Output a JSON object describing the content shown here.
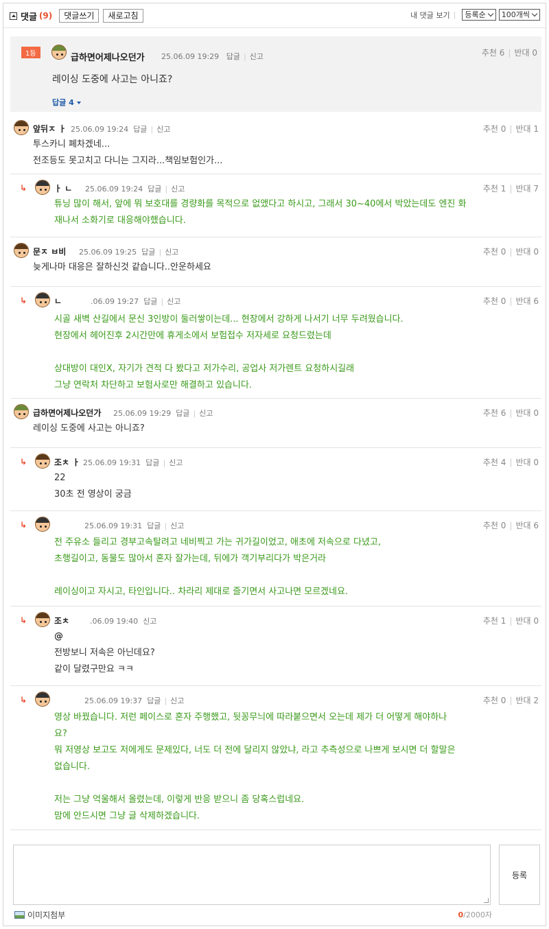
{
  "header": {
    "title": "댓글",
    "count": "(9)",
    "write_button": "댓글쓰기",
    "refresh_button": "새로고침",
    "my_comments": "내 댓글 보기",
    "sort_select": "등록순",
    "per_page_select": "100개씩"
  },
  "best_comment": {
    "badge": "1등",
    "author": "급하면어제나오던가",
    "datetime": "25.06.09 19:29",
    "reply_link": "답글",
    "report_link": "신고",
    "votes": "추천 6",
    "against": "반대 0",
    "text": "레이싱 도중에 사고는 아니죠?",
    "replies_toggle": "답글 4"
  },
  "comments": [
    {
      "author": "앞뒤ㅈ ㅏ",
      "datetime": "25.06.09 19:24",
      "reply_link": "답글",
      "report_link": "신고",
      "votes": "추천 0",
      "against": "반대 1",
      "text": "투스카니 폐차겠네...\n전조등도 못고치고 다니는 그지라...책임보험인가..."
    },
    {
      "author": "ㅏ ㄴ",
      "datetime": "25.06.09 19:24",
      "reply_link": "답글",
      "report_link": "신고",
      "votes": "추천 1",
      "against": "반대 7",
      "text": "튜닝 많이 해서, 앞에 뭐 보호대를 경량화를 목적으로 없앴다고 하시고, 그래서 30~40에서 박았는데도 엔진 화\n재나서 소화기로 대응해야했습니다."
    },
    {
      "author": "문ㅈ ㅂ비",
      "datetime": "25.06.09 19:25",
      "reply_link": "답글",
      "report_link": "신고",
      "votes": "추천 0",
      "against": "반대 0",
      "text": "늦게나마 대응은 잘하신것 같습니다..안운하세요"
    },
    {
      "author": "ㄴ",
      "datetime": ".06.09 19:27",
      "reply_link": "답글",
      "report_link": "신고",
      "votes": "추천 0",
      "against": "반대 6",
      "text": "시골 새벽 산길에서 문신 3인방이 둘러쌓이는데... 현장에서 강하게 나서기 너무 두려웠습니다.\n현장에서 헤어진후 2시간만에 휴게소에서 보험접수 저자세로 요청드렸는데\n\n상대방이 대인X, 자기가 견적 다 봤다고 저가수리, 공업사 저가렌트 요청하시길래\n그냥 연락처 차단하고 보험사로만 해결하고 있습니다."
    },
    {
      "author": "급하면어제나오던가",
      "datetime": "25.06.09 19:29",
      "reply_link": "답글",
      "report_link": "신고",
      "votes": "추천 6",
      "against": "반대 0",
      "text": "레이싱 도중에 사고는 아니죠?"
    },
    {
      "author": "조ㅊ ㅏ",
      "datetime": "25.06.09 19:31",
      "reply_link": "답글",
      "report_link": "신고",
      "votes": "추천 4",
      "against": "반대 0",
      "text": "22\n30초 전 영상이 궁금"
    },
    {
      "author": "",
      "datetime": "25.06.09 19:31",
      "reply_link": "답글",
      "report_link": "신고",
      "votes": "추천 0",
      "against": "반대 6",
      "text": "전 주유소 들리고 경부고속탈려고 네비찍고 가는 귀가길이었고, 애초에 저속으로 다녔고,\n초행길이고, 동물도 많아서 혼자 잘가는데, 뒤에가 객기부리다가 박은거라\n\n레이싱이고 자시고, 타인입니다.. 차라리 제대로 즐기면서 사고나면 모르겠네요."
    },
    {
      "author": "조ㅊ",
      "datetime": ".06.09 19:40",
      "report_link": "신고",
      "votes": "추천 1",
      "against": "반대 0",
      "mention": "@",
      "text": "전방보니 저속은 아닌데요?\n같이 달렸구만요 ㅋㅋ"
    },
    {
      "author": "",
      "datetime": "25.06.09 19:37",
      "reply_link": "답글",
      "report_link": "신고",
      "votes": "추천 0",
      "against": "반대 2",
      "text": "영상 바꿨습니다. 저런 페이스로 혼자 주행했고, 뒷꽁무늬에 따라붙으면서 오는데 제가 더 어떻게 해야하나\n요?\n뭐 저영상 보고도 저에게도 문제있다, 너도 더 전에 달리지 않았냐, 라고 추측성으로 나쁘게 보시면 더 할말은\n없습니다.\n\n저는 그냥 억울해서 올렸는데, 이렇게 반응 받으니 좀 당혹스럽네요.\n맘에 안드시면 그냥 글 삭제하겠습니다."
    }
  ],
  "compose": {
    "submit_button": "등록",
    "attach_label": "이미지첨부",
    "char_count": "0",
    "char_limit": "/2000자"
  }
}
